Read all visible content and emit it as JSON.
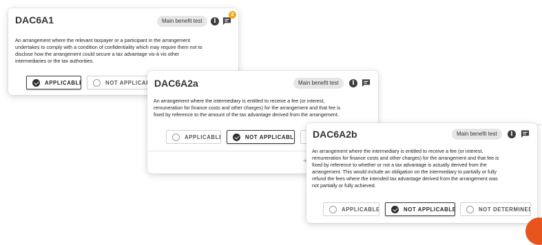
{
  "cards": [
    {
      "id": "dac6a1",
      "title": "DAC6A1",
      "pill": "Main benefit test",
      "badge_count": "2",
      "description": [
        "An arrangement where the relevant taxpayer or a participant in the arrangement",
        "undertakes to comply with a condition of confidentiality which may require them not to",
        "disclose how the arrangement could secure a tax advantage vis-à vis other",
        "intermediaries or the tax authorities."
      ],
      "options": [
        {
          "label": "APPLICABLE",
          "selected": true
        },
        {
          "label": "NOT APPLICABLE",
          "selected": false
        }
      ]
    },
    {
      "id": "dac6a2a",
      "title": "DAC6A2a",
      "pill": "Main benefit test",
      "description": [
        "An arrangement where the intermediary is entitled to receive a fee (or interest,",
        "remuneration for finance costs and other charges) for the arrangement and that fee is",
        "fixed by reference to the amount of the tax advantage derived from the arrangement."
      ],
      "options": [
        {
          "label": "APPLICABLE",
          "selected": false
        },
        {
          "label": "NOT APPLICABLE",
          "selected": true
        },
        {
          "label": "",
          "selected": false
        }
      ]
    },
    {
      "id": "dac6a2b",
      "title": "DAC6A2b",
      "pill": "Main benefit test",
      "description": [
        "An arrangement where the intermediary is entitled to receive a fee (or interest,",
        "remuneration for finance costs and other charges) for the arrangement and that fee is",
        "fixed by reference to whether or not a tax advantage is actually derived from the",
        "arrangement. This would include an obligation on the intermediary to partially or fully",
        "refund the fees where the intended tax advantage derived from the arrangement was",
        "not partially or fully achieved."
      ],
      "options": [
        {
          "label": "APPLICABLE",
          "selected": false
        },
        {
          "label": "NOT APPLICABLE",
          "selected": true
        },
        {
          "label": "NOT DETERMINED",
          "selected": false
        }
      ]
    }
  ],
  "plus_glyph": "+",
  "info_glyph": "i",
  "colors": {
    "badge": "#f5a623",
    "accent": "#e8541e"
  }
}
